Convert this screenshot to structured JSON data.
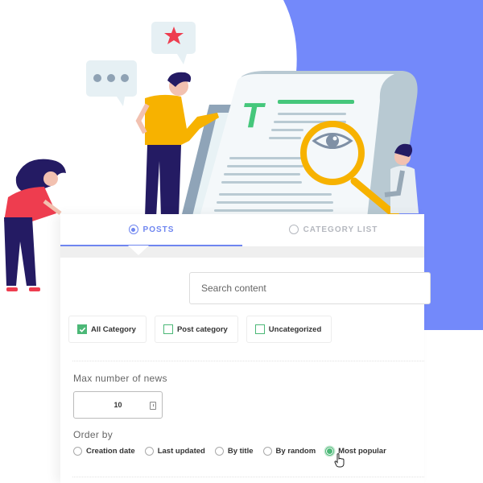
{
  "colors": {
    "accent": "#6f86f0",
    "check": "#4cb877",
    "blob": "#7389fa",
    "inactive_tab": "#b5b8bf"
  },
  "illustration": {
    "icons": [
      "chat-bubble-dots-icon",
      "chat-bubble-star-icon",
      "document-icon",
      "magnifier-eye-icon"
    ],
    "doc_letter": "T"
  },
  "tabs": [
    {
      "label": "POSTS",
      "active": true,
      "icon": "radio-selected-icon"
    },
    {
      "label": "CATEGORY LIST",
      "active": false,
      "icon": "radio-empty-icon"
    }
  ],
  "search": {
    "placeholder": "Search content",
    "value": ""
  },
  "categories": [
    {
      "label": "All Category",
      "checked": true
    },
    {
      "label": "Post category",
      "checked": false
    },
    {
      "label": "Uncategorized",
      "checked": false
    }
  ],
  "max_news": {
    "label": "Max number of news",
    "value": "10"
  },
  "order_by": {
    "label": "Order by",
    "options": [
      {
        "label": "Creation date",
        "selected": false
      },
      {
        "label": "Last updated",
        "selected": false
      },
      {
        "label": "By title",
        "selected": false
      },
      {
        "label": "By random",
        "selected": false
      },
      {
        "label": "Most popular",
        "selected": true
      }
    ]
  }
}
